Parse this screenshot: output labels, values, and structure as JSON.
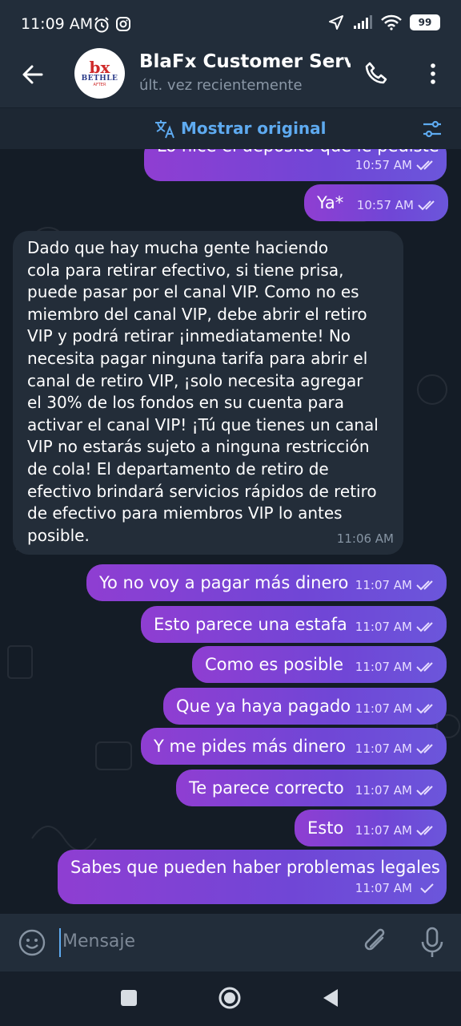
{
  "status": {
    "time": "11:09 AM",
    "battery": "99",
    "icons": [
      "alarm-icon",
      "instagram-icon",
      "location-icon",
      "signal-icon",
      "wifi-icon",
      "battery-icon"
    ]
  },
  "header": {
    "title": "BlaFx Customer Servic",
    "subtitle": "últ. vez recientemente",
    "avatar": {
      "mark": "bx",
      "text": "BETHLE",
      "sub": "AFTER"
    }
  },
  "translate": {
    "label": "Mostrar original"
  },
  "messages": [
    {
      "text": "Lo hice el depósito que le pediste",
      "time": "10:57 AM",
      "direction": "out",
      "read": true
    },
    {
      "text": "Ya*",
      "time": "10:57 AM",
      "direction": "out",
      "read": true
    },
    {
      "lines": [
        "Dado que hay mucha gente haciendo",
        "cola para retirar efectivo, si tiene prisa,",
        "puede pasar por el canal VIP. Como no es",
        "miembro del canal VIP, debe abrir el retiro",
        "VIP y podrá retirar ¡inmediatamente! No",
        "necesita pagar ninguna tarifa para abrir el",
        "canal de retiro VIP, ¡solo necesita agregar",
        "el 30% de los fondos en su cuenta para",
        "activar el canal VIP! ¡Tú que tienes un canal",
        "VIP no estarás sujeto a ninguna restricción",
        "de cola! El departamento de retiro de",
        "efectivo brindará servicios rápidos de retiro",
        "de efectivo para miembros VIP lo antes",
        "posible."
      ],
      "time": "11:06 AM",
      "direction": "in"
    },
    {
      "text": "Yo no voy a pagar más dinero",
      "time": "11:07 AM",
      "direction": "out",
      "read": true
    },
    {
      "text": "Esto parece una estafa",
      "time": "11:07 AM",
      "direction": "out",
      "read": true
    },
    {
      "text": "Como es posible",
      "time": "11:07 AM",
      "direction": "out",
      "read": true
    },
    {
      "text": "Que ya haya pagado",
      "time": "11:07 AM",
      "direction": "out",
      "read": true
    },
    {
      "text": "Y me pides más dinero",
      "time": "11:07 AM",
      "direction": "out",
      "read": true
    },
    {
      "text": "Te parece correcto",
      "time": "11:07 AM",
      "direction": "out",
      "read": true
    },
    {
      "text": "Esto",
      "time": "11:07 AM",
      "direction": "out",
      "read": true
    },
    {
      "text": "Sabes que pueden haber problemas legales",
      "time": "11:07 AM",
      "direction": "out",
      "read": false
    }
  ],
  "composer": {
    "placeholder": "Mensaje"
  },
  "colors": {
    "accent": "#5eaaf0",
    "bubble_out_start": "#8f3ed2",
    "bubble_out_end": "#6b56db",
    "bubble_in": "#232d39"
  }
}
